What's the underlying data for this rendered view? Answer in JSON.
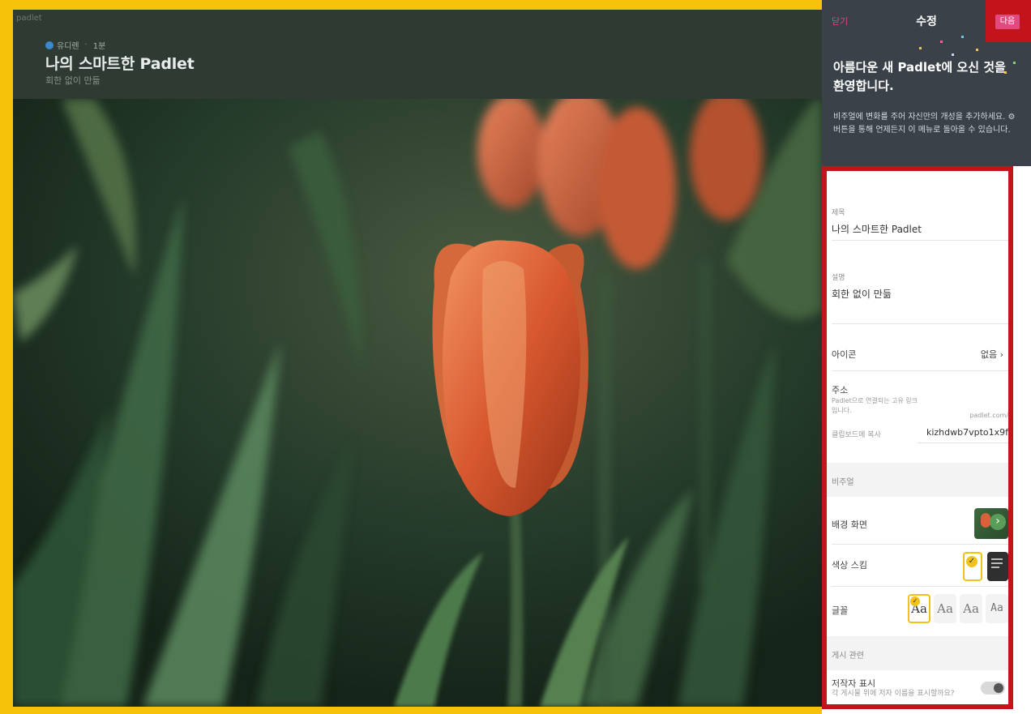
{
  "app": {
    "brand": "padlet"
  },
  "header": {
    "author_name": "유디렌",
    "time": "1분",
    "title": "나의 스마트한 Padlet",
    "subtitle": "회한 없이 만듦"
  },
  "panel": {
    "close_label": "닫기",
    "title": "수정",
    "next_label": "다음",
    "welcome_title": "아름다운 새 Padlet에 오신 것을 환영합니다.",
    "welcome_body": "비주얼에 변화를 주어 자신만의 개성을 추가하세요. ⚙ 버튼을 통해 언제든지 이 메뉴로 돌아올 수 있습니다.",
    "fields": {
      "title_label": "제목",
      "title_value": "나의 스마트한 Padlet",
      "desc_label": "설명",
      "desc_value": "회한 없이 만듦",
      "icon_label": "아이콘",
      "icon_value": "없음 ›",
      "address_label": "주소",
      "address_help": "Padlet으로 연결되는 고유 링크입니다.",
      "address_domain": "padlet.com/",
      "copy_label": "클립보드에 복사",
      "address_slug": "kizhdwb7vpto1x9f"
    },
    "visual": {
      "section_label": "비주얼",
      "wallpaper_label": "배경 화면",
      "color_scheme_label": "색상 스킴",
      "font_label": "글꼴",
      "font_options": [
        "Aa",
        "Aa",
        "Aa",
        "Aa"
      ]
    },
    "posting": {
      "section_label": "게시 관련",
      "attribution_label": "저작자 표시",
      "attribution_help": "각 게시물 위에 저자 이름을 표시할까요?",
      "attribution_on": false
    }
  },
  "colors": {
    "highlight_outer": "#f6c30a",
    "highlight_red": "#c3131b",
    "accent_pink": "#e04a7e",
    "panel_dark": "#3a4149"
  }
}
